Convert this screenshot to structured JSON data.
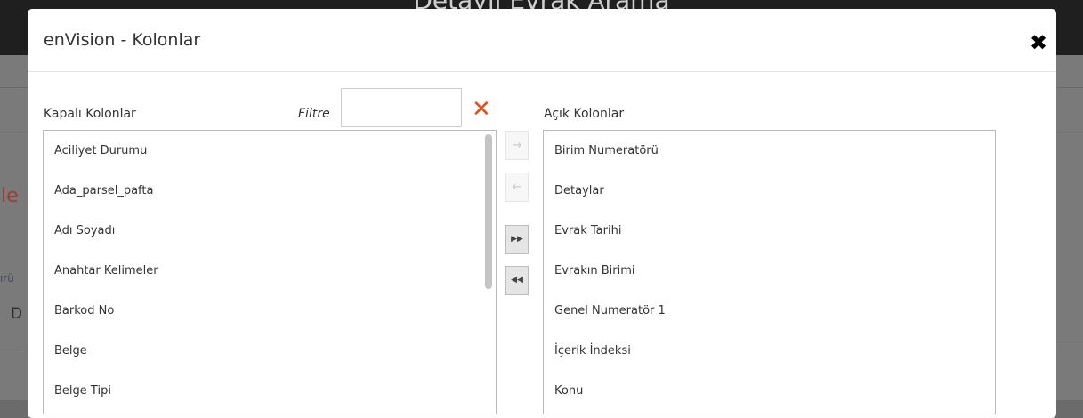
{
  "background": {
    "page_title": "Detaylı Evrak Arama",
    "red_text": "le",
    "small_text": "ırü",
    "letter": "D"
  },
  "modal": {
    "title": "enVision - Kolonlar",
    "close_icon": "✖"
  },
  "closed_columns": {
    "label": "Kapalı Kolonlar",
    "filter_label": "Filtre",
    "filter_value": "",
    "clear_icon": "✕",
    "items": [
      "Aciliyet Durumu",
      "Ada_parsel_pafta",
      "Adı Soyadı",
      "Anahtar Kelimeler",
      "Barkod No",
      "Belge",
      "Belge Tipi"
    ]
  },
  "open_columns": {
    "label": "Açık Kolonlar",
    "items": [
      "Birim Numeratörü",
      "Detaylar",
      "Evrak Tarihi",
      "Evrakın Birimi",
      "Genel Numeratör 1",
      "İçerik İndeksi",
      "Konu"
    ]
  },
  "move_buttons": {
    "move_right": "→",
    "move_left": "←",
    "move_all_right": "▶▶",
    "move_all_left": "◀◀"
  }
}
